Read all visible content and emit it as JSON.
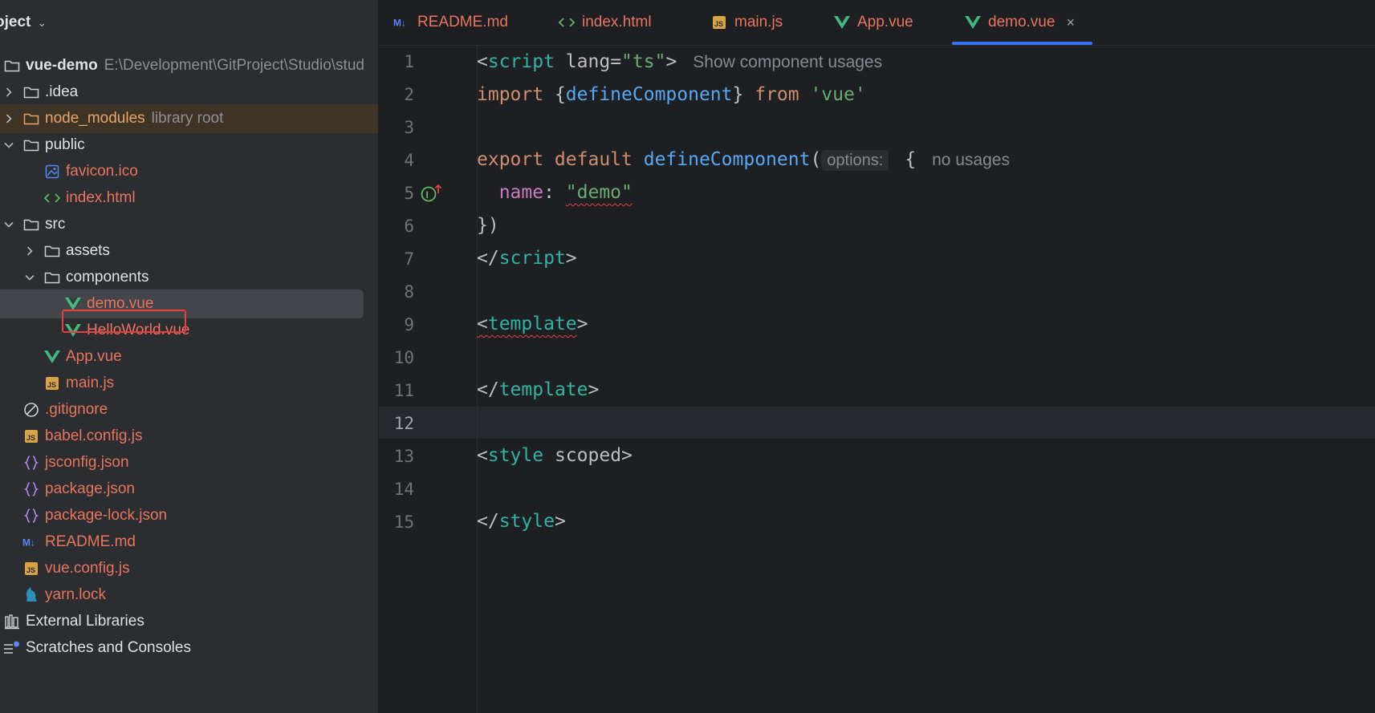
{
  "project": {
    "header": "oject",
    "root": {
      "name": "vue-demo",
      "path": "E:\\Development\\GitProject\\Studio\\stud"
    },
    "items": [
      {
        "label": ".idea",
        "type": "folder",
        "indent": 1,
        "expanded": false
      },
      {
        "label": "node_modules",
        "hint": "library root",
        "type": "folder",
        "indent": 1,
        "expanded": false
      },
      {
        "label": "public",
        "type": "folder",
        "indent": 1,
        "expanded": true
      },
      {
        "label": "favicon.ico",
        "type": "image",
        "indent": 2
      },
      {
        "label": "index.html",
        "type": "html",
        "indent": 2
      },
      {
        "label": "src",
        "type": "folder",
        "indent": 1,
        "expanded": true
      },
      {
        "label": "assets",
        "type": "folder",
        "indent": 2,
        "expanded": false
      },
      {
        "label": "components",
        "type": "folder",
        "indent": 2,
        "expanded": true
      },
      {
        "label": "demo.vue",
        "type": "vue",
        "indent": 3,
        "selected": true
      },
      {
        "label": "HelloWorld.vue",
        "type": "vue",
        "indent": 3
      },
      {
        "label": "App.vue",
        "type": "vue",
        "indent": 2
      },
      {
        "label": "main.js",
        "type": "js",
        "indent": 2
      },
      {
        "label": ".gitignore",
        "type": "ignore",
        "indent": 1
      },
      {
        "label": "babel.config.js",
        "type": "js",
        "indent": 1
      },
      {
        "label": "jsconfig.json",
        "type": "json",
        "indent": 1
      },
      {
        "label": "package.json",
        "type": "json",
        "indent": 1
      },
      {
        "label": "package-lock.json",
        "type": "json",
        "indent": 1
      },
      {
        "label": "README.md",
        "type": "md",
        "indent": 1
      },
      {
        "label": "vue.config.js",
        "type": "js",
        "indent": 1
      },
      {
        "label": "yarn.lock",
        "type": "yarn",
        "indent": 1
      },
      {
        "label": "External Libraries",
        "type": "libs",
        "indent": 0
      },
      {
        "label": "Scratches and Consoles",
        "type": "scratch",
        "indent": 0
      }
    ]
  },
  "tabs": [
    {
      "label": "README.md",
      "icon": "markdown-icon"
    },
    {
      "label": "index.html",
      "icon": "html-icon"
    },
    {
      "label": "main.js",
      "icon": "js-icon"
    },
    {
      "label": "App.vue",
      "icon": "vue-icon"
    },
    {
      "label": "demo.vue",
      "icon": "vue-icon",
      "active": true,
      "close": "×"
    }
  ],
  "editor": {
    "line_numbers": [
      "1",
      "2",
      "3",
      "4",
      "5",
      "6",
      "7",
      "8",
      "9",
      "10",
      "11",
      "12",
      "13",
      "14",
      "15"
    ],
    "current_line": "12",
    "code": {
      "l1": {
        "open": "<",
        "tag": "script",
        "attr": " lang=",
        "val": "\"ts\"",
        "close": ">",
        "hint": "Show component usages"
      },
      "l2": {
        "kw": "import",
        "brace_open": " {",
        "fn": "defineComponent",
        "brace_close": "} ",
        "kw2": "from",
        "str": " 'vue'"
      },
      "l4": {
        "kw": "export default",
        "fn": " defineComponent",
        "paren": "(",
        "param_hint": "options:",
        "brace": " {",
        "hint": "no usages"
      },
      "l5": {
        "prop": "  name",
        "colon": ": ",
        "str": "\"demo\""
      },
      "l6": {
        "text": "})"
      },
      "l7": {
        "open": "</",
        "tag": "script",
        "close": ">"
      },
      "l9": {
        "open": "<",
        "tag": "template",
        "close": ">"
      },
      "l11": {
        "open": "</",
        "tag": "template",
        "close": ">"
      },
      "l13": {
        "open": "<",
        "tag": "style",
        "attr": " scoped",
        "close": ">"
      },
      "l15": {
        "open": "</",
        "tag": "style",
        "close": ">"
      }
    }
  }
}
